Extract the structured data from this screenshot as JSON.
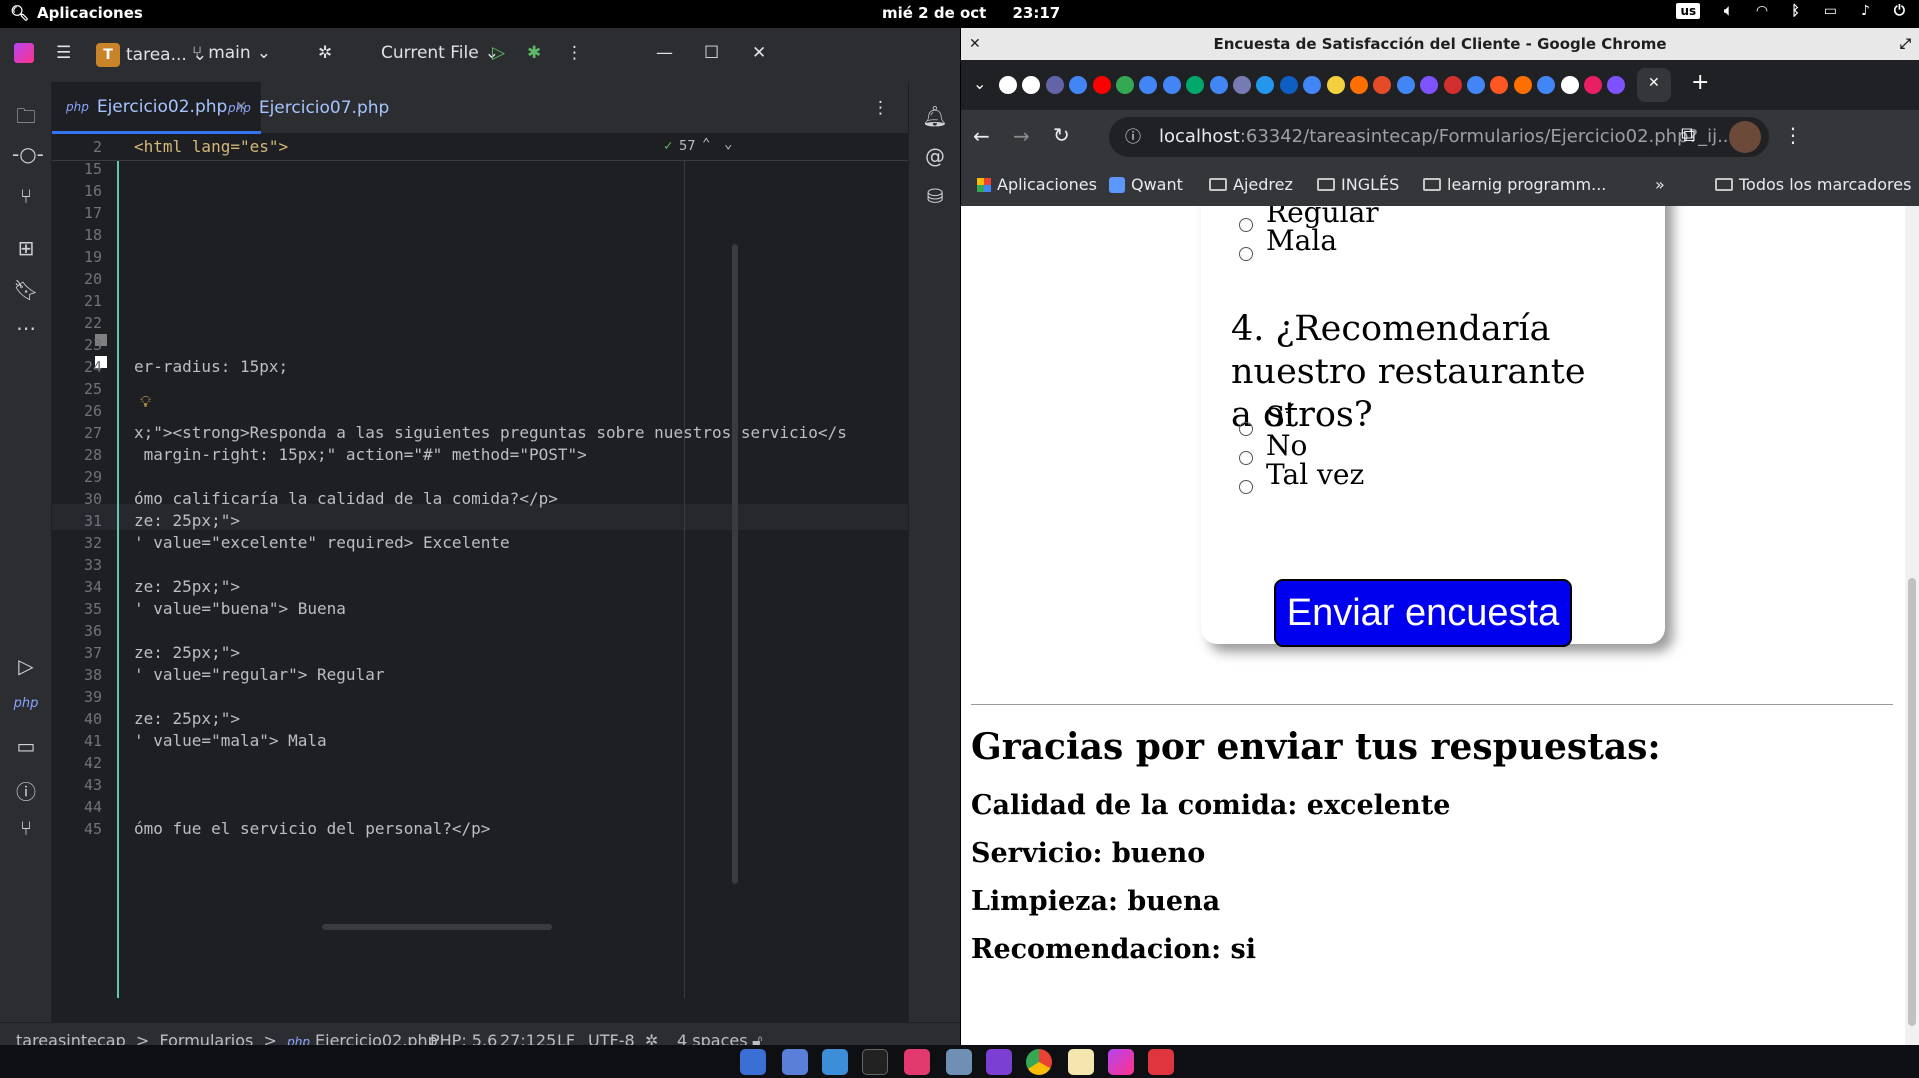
{
  "system": {
    "apps_label": "Aplicaciones",
    "date": "mié 2 de oct",
    "time": "23:17",
    "keyboard": "us"
  },
  "ide": {
    "project": "tarea...",
    "project_initial": "T",
    "branch": "main",
    "run_config": "Current File",
    "tabs": [
      {
        "label": "Ejercicio02.php",
        "lang": "php",
        "active": true
      },
      {
        "label": "Ejercicio07.php",
        "lang": "php",
        "active": false
      }
    ],
    "inspection_count": "57",
    "sticky": {
      "num": "2",
      "text": "<html lang=\"es\">"
    },
    "lines": [
      {
        "num": "15",
        "text": ""
      },
      {
        "num": "16",
        "text": ""
      },
      {
        "num": "17",
        "text": ""
      },
      {
        "num": "18",
        "text": ""
      },
      {
        "num": "19",
        "text": ""
      },
      {
        "num": "20",
        "text": ""
      },
      {
        "num": "21",
        "text": ""
      },
      {
        "num": "22",
        "text": ""
      },
      {
        "num": "23",
        "text": ""
      },
      {
        "num": "24",
        "text": "er-radius: 15px;"
      },
      {
        "num": "25",
        "text": ""
      },
      {
        "num": "26",
        "text": ""
      },
      {
        "num": "27",
        "text": "x;\"><strong>Responda a las siguientes preguntas sobre nuestros servicio</s"
      },
      {
        "num": "28",
        "text": " margin-right: 15px;\" action=\"#\" method=\"POST\">"
      },
      {
        "num": "29",
        "text": ""
      },
      {
        "num": "30",
        "text": "ómo calificaría la calidad de la comida?</p>"
      },
      {
        "num": "31",
        "text": "ze: 25px;\">"
      },
      {
        "num": "32",
        "text": "' value=\"excelente\" required> Excelente"
      },
      {
        "num": "33",
        "text": ""
      },
      {
        "num": "34",
        "text": "ze: 25px;\">"
      },
      {
        "num": "35",
        "text": "' value=\"buena\"> Buena"
      },
      {
        "num": "36",
        "text": ""
      },
      {
        "num": "37",
        "text": "ze: 25px;\">"
      },
      {
        "num": "38",
        "text": "' value=\"regular\"> Regular"
      },
      {
        "num": "39",
        "text": ""
      },
      {
        "num": "40",
        "text": "ze: 25px;\">"
      },
      {
        "num": "41",
        "text": "' value=\"mala\"> Mala"
      },
      {
        "num": "42",
        "text": ""
      },
      {
        "num": "43",
        "text": ""
      },
      {
        "num": "44",
        "text": ""
      },
      {
        "num": "45",
        "text": "ómo fue el servicio del personal?</p>"
      }
    ],
    "status": {
      "crumb_project": "tareasintecap",
      "crumb_folder": "Formularios",
      "crumb_file": "Ejercicio02.php",
      "php_version": "PHP: 5.6",
      "position": "27:125",
      "line_sep": "LF",
      "encoding": "UTF-8",
      "indent": "4 spaces"
    }
  },
  "chrome": {
    "window_title": "Encuesta de Satisfacción del Cliente - Google Chrome",
    "url_host": "localhost",
    "url_rest": ":63342/tareasintecap/Formularios/Ejercicio02.php?_ij...",
    "bookmarks": [
      "Aplicaciones",
      "Qwant",
      "Ajedrez",
      "INGLÉS",
      "learnig programm..."
    ],
    "all_bookmarks": "Todos los marcadores",
    "page": {
      "prev_options": [
        "Regular",
        "Mala"
      ],
      "question4": "4. ¿Recomendaría nuestro restaurante a otros?",
      "q4_options": [
        "Sí",
        "No",
        "Tal vez"
      ],
      "submit": "Enviar encuesta",
      "thanks": "Gracias por enviar tus respuestas:",
      "results": [
        "Calidad de la comida: excelente",
        "Servicio: bueno",
        "Limpieza: buena",
        "Recomendacion: si"
      ]
    }
  },
  "colors": {
    "ide_bg": "#1e1f22",
    "ide_panel": "#2b2d30",
    "accent": "#3574f0",
    "button_blue": "#0000ee"
  }
}
